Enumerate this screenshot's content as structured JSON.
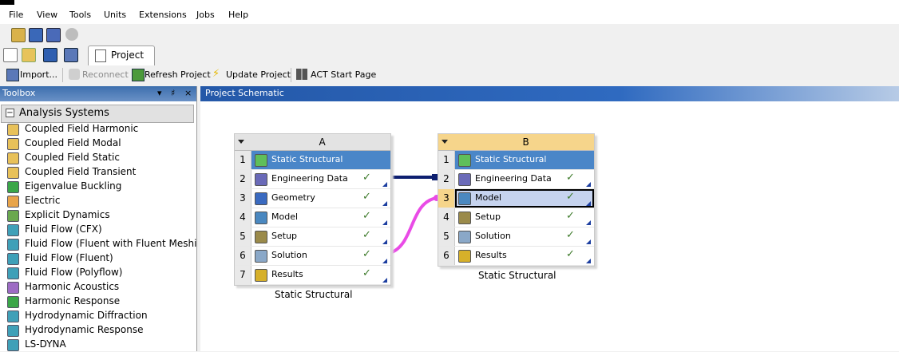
{
  "menu": [
    "File",
    "View",
    "Tools",
    "Units",
    "Extensions",
    "Jobs",
    "Help"
  ],
  "tab": {
    "label": "Project"
  },
  "toolbar": {
    "import": "Import...",
    "reconnect": "Reconnect",
    "refresh": "Refresh Project",
    "update": "Update Project",
    "act": "ACT Start Page"
  },
  "toolbox": {
    "title": "Toolbox",
    "pin": "▾ ♯ ×",
    "group": "Analysis Systems",
    "items": [
      {
        "label": "Coupled Field Harmonic",
        "icon": "coupled-field-icon",
        "color": "#e8c15a"
      },
      {
        "label": "Coupled Field Modal",
        "icon": "coupled-field-icon",
        "color": "#e8c15a"
      },
      {
        "label": "Coupled Field Static",
        "icon": "coupled-field-icon",
        "color": "#e8c15a"
      },
      {
        "label": "Coupled Field Transient",
        "icon": "coupled-field-icon",
        "color": "#e8c15a"
      },
      {
        "label": "Eigenvalue Buckling",
        "icon": "buckling-icon",
        "color": "#3aa648"
      },
      {
        "label": "Electric",
        "icon": "electric-icon",
        "color": "#e8a44a"
      },
      {
        "label": "Explicit Dynamics",
        "icon": "explicit-dynamics-icon",
        "color": "#6aa84f"
      },
      {
        "label": "Fluid Flow (CFX)",
        "icon": "cfx-icon",
        "color": "#3fa0b8"
      },
      {
        "label": "Fluid Flow (Fluent with Fluent Meshing)",
        "icon": "fluent-icon",
        "color": "#3fa0b8"
      },
      {
        "label": "Fluid Flow (Fluent)",
        "icon": "fluent-icon",
        "color": "#3fa0b8"
      },
      {
        "label": "Fluid Flow (Polyflow)",
        "icon": "polyflow-icon",
        "color": "#3fa0b8"
      },
      {
        "label": "Harmonic Acoustics",
        "icon": "acoustics-icon",
        "color": "#9d6bc4"
      },
      {
        "label": "Harmonic Response",
        "icon": "harmonic-icon",
        "color": "#3aa648"
      },
      {
        "label": "Hydrodynamic Diffraction",
        "icon": "hydro-icon",
        "color": "#3fa0b8"
      },
      {
        "label": "Hydrodynamic Response",
        "icon": "hydro-icon",
        "color": "#3fa0b8"
      },
      {
        "label": "LS-DYNA",
        "icon": "lsdyna-icon",
        "color": "#3fa0b8"
      }
    ]
  },
  "schematic": {
    "title": "Project Schematic",
    "systems": [
      {
        "letter": "A",
        "name": "Static Structural",
        "rows": [
          {
            "n": "1",
            "label": "Static Structural",
            "icon": "static-structural-icon",
            "check": ""
          },
          {
            "n": "2",
            "label": "Engineering Data",
            "icon": "engineering-data-icon",
            "check": "✓"
          },
          {
            "n": "3",
            "label": "Geometry",
            "icon": "geometry-icon",
            "check": "✓"
          },
          {
            "n": "4",
            "label": "Model",
            "icon": "model-icon",
            "check": "✓"
          },
          {
            "n": "5",
            "label": "Setup",
            "icon": "setup-icon",
            "check": "✓"
          },
          {
            "n": "6",
            "label": "Solution",
            "icon": "solution-icon",
            "check": "✓"
          },
          {
            "n": "7",
            "label": "Results",
            "icon": "results-icon",
            "check": "✓"
          }
        ]
      },
      {
        "letter": "B",
        "name": "Static Structural",
        "rows": [
          {
            "n": "1",
            "label": "Static Structural",
            "icon": "static-structural-icon",
            "check": ""
          },
          {
            "n": "2",
            "label": "Engineering Data",
            "icon": "engineering-data-icon",
            "check": "✓"
          },
          {
            "n": "3",
            "label": "Model",
            "icon": "model-icon",
            "check": "✓"
          },
          {
            "n": "4",
            "label": "Setup",
            "icon": "setup-icon",
            "check": "✓"
          },
          {
            "n": "5",
            "label": "Solution",
            "icon": "solution-icon",
            "check": "✓"
          },
          {
            "n": "6",
            "label": "Results",
            "icon": "results-icon",
            "check": "✓"
          }
        ]
      }
    ]
  },
  "colors": {
    "link_engineering": "#0d1f70",
    "link_solution": "#e94be6",
    "title_row": "#4a86c8",
    "selected_header": "#f6d58b",
    "check": "#3d7a2a"
  }
}
